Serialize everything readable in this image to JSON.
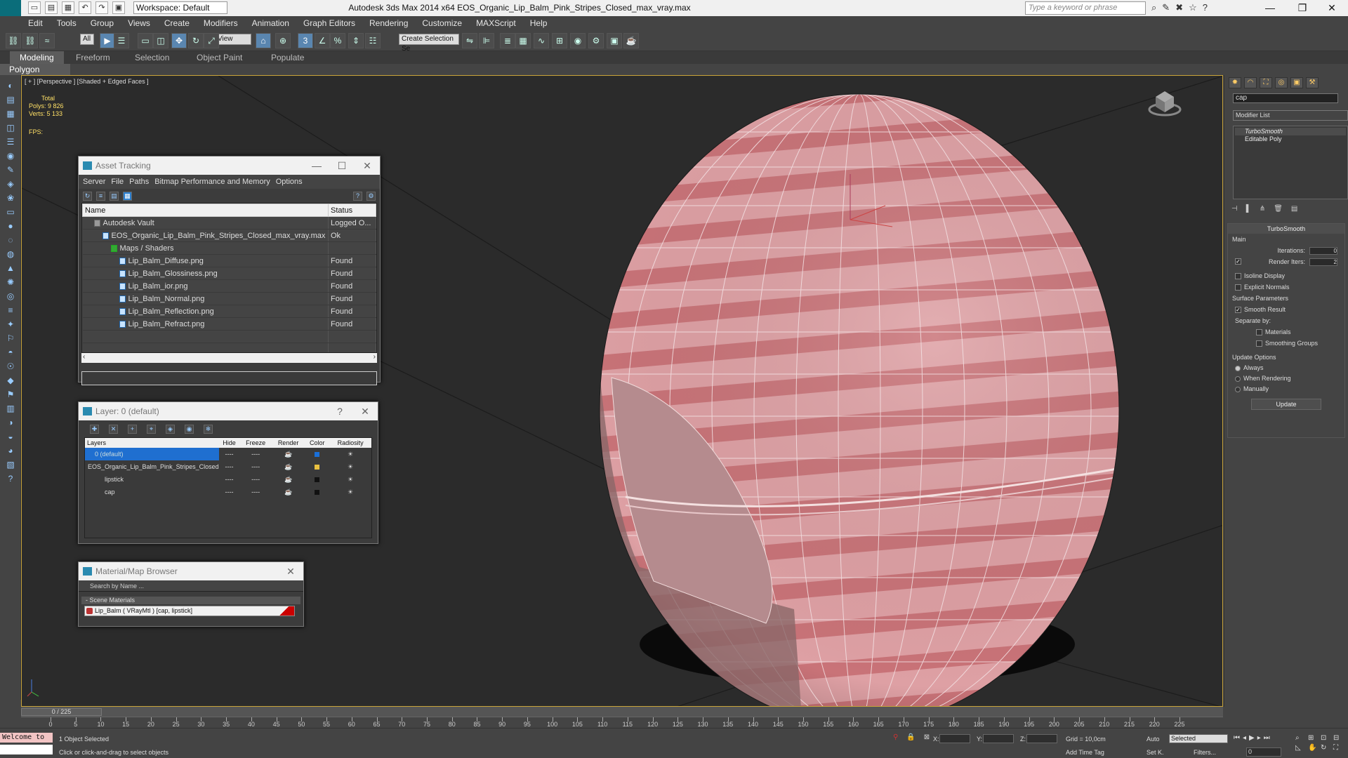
{
  "titlebar": {
    "workspace": "Workspace: Default",
    "app_title": "Autodesk 3ds Max  2014 x64     EOS_Organic_Lip_Balm_Pink_Stripes_Closed_max_vray.max",
    "search_placeholder": "Type a keyword or phrase",
    "minimize": "—",
    "restore": "❐",
    "close": "✕"
  },
  "menubar": [
    "Edit",
    "Tools",
    "Group",
    "Views",
    "Create",
    "Modifiers",
    "Animation",
    "Graph Editors",
    "Rendering",
    "Customize",
    "MAXScript",
    "Help"
  ],
  "toolbar": {
    "filter": "All",
    "view_select": "View",
    "selection_set": "Create Selection Se",
    "icons": [
      "link-icon",
      "unlink-icon",
      "bind-icon",
      "select-icon",
      "select-by-name-icon",
      "rect-region-icon",
      "window-crossing-icon",
      "move-icon",
      "rotate-icon",
      "scale-icon",
      "ref-coord-icon",
      "pivot-icon",
      "snap-icon",
      "angle-snap-icon",
      "percent-snap-icon",
      "spinner-snap-icon",
      "edit-named-sel-icon",
      "mirror-icon",
      "align-icon",
      "layer-manager-icon",
      "ribbon-icon",
      "curve-editor-icon",
      "schematic-icon",
      "material-editor-icon",
      "render-setup-icon",
      "render-frame-icon",
      "render-icon"
    ]
  },
  "ribbon": {
    "tabs": [
      "Modeling",
      "Freeform",
      "Selection",
      "Object Paint",
      "Populate"
    ],
    "sub_label": "Polygon Modeling"
  },
  "viewport": {
    "label": "[ + ] [Perspective ] [Shaded + Edged Faces ]",
    "stats_header": "Total",
    "polys_label": "Polys:",
    "polys_value": "9 826",
    "verts_label": "Verts:",
    "verts_value": "5 133",
    "fps_label": "FPS:"
  },
  "asset_tracking": {
    "title": "Asset Tracking",
    "menu": [
      "Server",
      "File",
      "Paths",
      "Bitmap Performance and Memory",
      "Options"
    ],
    "columns": [
      "Name",
      "Status"
    ],
    "rows": [
      {
        "name": "Autodesk Vault",
        "status": "Logged O...",
        "indent": 1
      },
      {
        "name": "EOS_Organic_Lip_Balm_Pink_Stripes_Closed_max_vray.max",
        "status": "Ok",
        "indent": 2
      },
      {
        "name": "Maps / Shaders",
        "status": "",
        "indent": 3
      },
      {
        "name": "Lip_Balm_Diffuse.png",
        "status": "Found",
        "indent": 4
      },
      {
        "name": "Lip_Balm_Glossiness.png",
        "status": "Found",
        "indent": 4
      },
      {
        "name": "Lip_Balm_ior.png",
        "status": "Found",
        "indent": 4
      },
      {
        "name": "Lip_Balm_Normal.png",
        "status": "Found",
        "indent": 4
      },
      {
        "name": "Lip_Balm_Reflection.png",
        "status": "Found",
        "indent": 4
      },
      {
        "name": "Lip_Balm_Refract.png",
        "status": "Found",
        "indent": 4
      }
    ]
  },
  "layer_manager": {
    "title": "Layer: 0 (default)",
    "help": "?",
    "columns": [
      "Layers",
      "Hide",
      "Freeze",
      "Render",
      "Color",
      "Radiosity"
    ],
    "rows": [
      {
        "name": "0 (default)",
        "selected": true,
        "color": "#1a6fd8"
      },
      {
        "name": "EOS_Organic_Lip_Balm_Pink_Stripes_Closed",
        "selected": false,
        "color": "#e8c040"
      },
      {
        "name": "lipstick",
        "selected": false,
        "color": "#111111"
      },
      {
        "name": "cap",
        "selected": false,
        "color": "#111111"
      }
    ],
    "hide": "----",
    "freeze": "----"
  },
  "material_browser": {
    "title": "Material/Map Browser",
    "search_placeholder": "Search by Name ...",
    "group": "- Scene Materials",
    "material": "Lip_Balm  ( VRayMtl ) [cap, lipstick]"
  },
  "command_panel": {
    "object_name": "cap",
    "modifier_list": "Modifier List",
    "stack": [
      "TurboSmooth",
      "Editable Poly"
    ],
    "rollout_title": "TurboSmooth",
    "main_label": "Main",
    "iterations_label": "Iterations:",
    "iterations_value": "0",
    "render_iters_label": "Render Iters:",
    "render_iters_value": "2",
    "isoline": "Isoline Display",
    "explicit_normals": "Explicit Normals",
    "surface_params": "Surface Parameters",
    "smooth_result": "Smooth Result",
    "separate_by": "Separate by:",
    "materials": "Materials",
    "smoothing_groups": "Smoothing Groups",
    "update_options": "Update Options",
    "always": "Always",
    "when_rendering": "When Rendering",
    "manually": "Manually",
    "update_button": "Update"
  },
  "timeline": {
    "slider_label": "0 / 225",
    "ticks": [
      0,
      5,
      10,
      15,
      20,
      25,
      30,
      35,
      40,
      45,
      50,
      55,
      60,
      65,
      70,
      75,
      80,
      85,
      90,
      95,
      100,
      105,
      110,
      115,
      120,
      125,
      130,
      135,
      140,
      145,
      150,
      155,
      160,
      165,
      170,
      175,
      180,
      185,
      190,
      195,
      200,
      205,
      210,
      215,
      220,
      225
    ]
  },
  "statusbar": {
    "maxscript": "Welcome to",
    "objects_selected": "1 Object Selected",
    "prompt": "Click or click-and-drag to select objects",
    "x_label": "X:",
    "y_label": "Y:",
    "z_label": "Z:",
    "grid": "Grid = 10,0cm",
    "add_time_tag": "Add Time Tag",
    "auto": "Auto",
    "selected": "Selected",
    "set_k": "Set K.",
    "filters": "Filters...",
    "frame": "0"
  }
}
